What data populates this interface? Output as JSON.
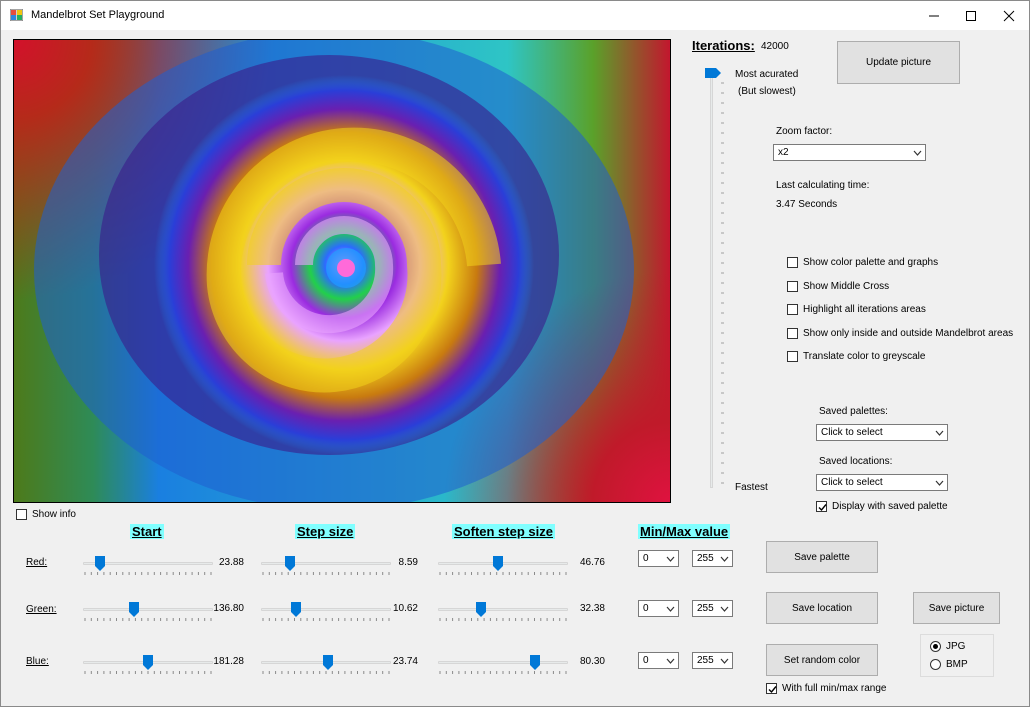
{
  "window": {
    "title": "Mandelbrot Set Playground",
    "controls": {
      "minimize": "minimize",
      "maximize": "maximize",
      "close": "close"
    }
  },
  "iterations": {
    "label": "Iterations:",
    "value": "42000",
    "top_label": "Most acurated",
    "top_sub": "(But slowest)",
    "bottom_label": "Fastest",
    "level": 1.0
  },
  "update_button": "Update picture",
  "zoom": {
    "label": "Zoom factor:",
    "value": "x2"
  },
  "calc": {
    "label": "Last calculating time:",
    "value": "3.47 Seconds"
  },
  "options": [
    {
      "label": "Show color palette and graphs",
      "checked": false
    },
    {
      "label": "Show Middle Cross",
      "checked": false
    },
    {
      "label": "Highlight all iterations areas",
      "checked": false
    },
    {
      "label": "Show only inside and outside Mandelbrot areas",
      "checked": false
    },
    {
      "label": "Translate color to greyscale",
      "checked": false
    }
  ],
  "saved_palettes": {
    "label": "Saved palettes:",
    "value": "Click to select"
  },
  "saved_locations": {
    "label": "Saved locations:",
    "value": "Click to select"
  },
  "display_saved_palette": {
    "label": "Display with saved palette",
    "checked": true
  },
  "show_info": {
    "label": "Show info",
    "checked": false
  },
  "headers": {
    "start": "Start",
    "step": "Step size",
    "soften": "Soften step size",
    "minmax": "Min/Max value"
  },
  "channels": [
    {
      "name": "Red:",
      "start": "23.88",
      "step": "8.59",
      "soften": "46.76",
      "min": "0",
      "max": "255",
      "start_level": 0.1,
      "step_level": 0.2,
      "soften_level": 0.46
    },
    {
      "name": "Green:",
      "start": "136.80",
      "step": "10.62",
      "soften": "32.38",
      "min": "0",
      "max": "255",
      "start_level": 0.38,
      "step_level": 0.25,
      "soften_level": 0.32
    },
    {
      "name": "Blue:",
      "start": "181.28",
      "step": "23.74",
      "soften": "80.30",
      "min": "0",
      "max": "255",
      "start_level": 0.5,
      "step_level": 0.52,
      "soften_level": 0.77
    }
  ],
  "buttons": {
    "save_palette": "Save  palette",
    "save_location": "Save location",
    "save_picture": "Save picture",
    "random_color": "Set random color"
  },
  "full_range": {
    "label": "With full min/max range",
    "checked": true
  },
  "format": {
    "options": [
      "JPG",
      "BMP"
    ],
    "selected": "JPG"
  },
  "colors": {
    "accent": "#0078d7",
    "header_bg": "#80ffff"
  },
  "image": {
    "subject": "Mandelbrot spiral fractal rendered in rainbow palette"
  }
}
